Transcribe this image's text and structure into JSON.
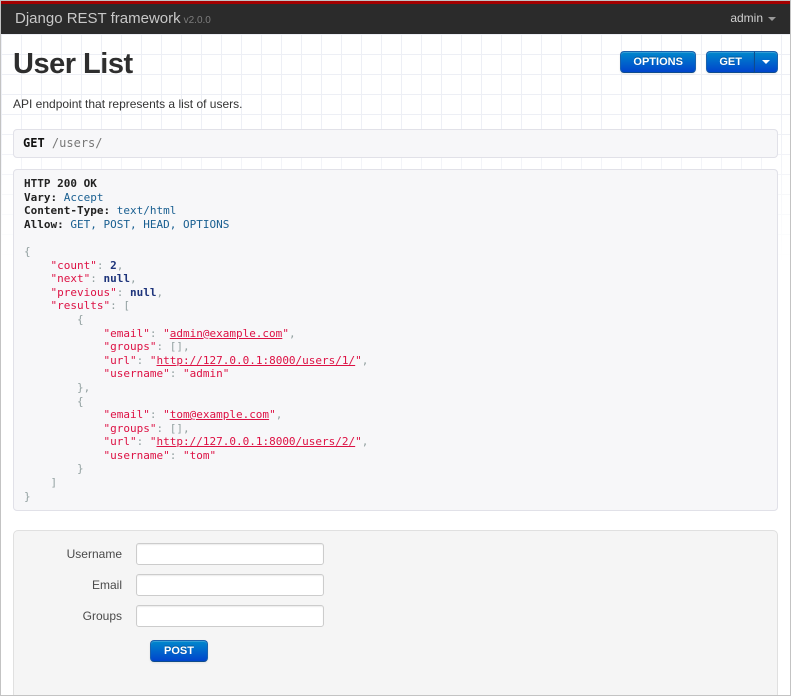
{
  "navbar": {
    "brand": "Django REST framework",
    "version": "v2.0.0",
    "user_menu_label": "admin"
  },
  "page": {
    "title": "User List",
    "description": "API endpoint that represents a list of users."
  },
  "toolbar": {
    "options_label": "OPTIONS",
    "get_label": "GET"
  },
  "request": {
    "method": "GET",
    "path": "/users/"
  },
  "response": {
    "status_line": "HTTP 200 OK",
    "headers": [
      {
        "name": "Vary",
        "value": "Accept"
      },
      {
        "name": "Content-Type",
        "value": "text/html"
      },
      {
        "name": "Allow",
        "value": "GET, POST, HEAD, OPTIONS"
      }
    ],
    "body": {
      "count": 2,
      "next": null,
      "previous": null,
      "results": [
        {
          "email": "admin@example.com",
          "groups": [],
          "url": "http://127.0.0.1:8000/users/1/",
          "username": "admin"
        },
        {
          "email": "tom@example.com",
          "groups": [],
          "url": "http://127.0.0.1:8000/users/2/",
          "username": "tom"
        }
      ]
    }
  },
  "form": {
    "fields": [
      {
        "label": "Username",
        "value": ""
      },
      {
        "label": "Email",
        "value": ""
      },
      {
        "label": "Groups",
        "value": ""
      }
    ],
    "submit_label": "POST"
  },
  "colors": {
    "navbar_bg": "#2b2b2b",
    "accent_red": "#a30000",
    "button_blue_top": "#0088cc",
    "button_blue_bottom": "#0044cc",
    "panel_bg": "#f7f7f9",
    "panel_border": "#e1e1e8",
    "form_panel_bg": "#f5f5f5",
    "json_string": "#dd1144",
    "json_literal": "#1e347b",
    "json_punctuation": "#93a1a1",
    "header_value_blue": "#195f91"
  }
}
